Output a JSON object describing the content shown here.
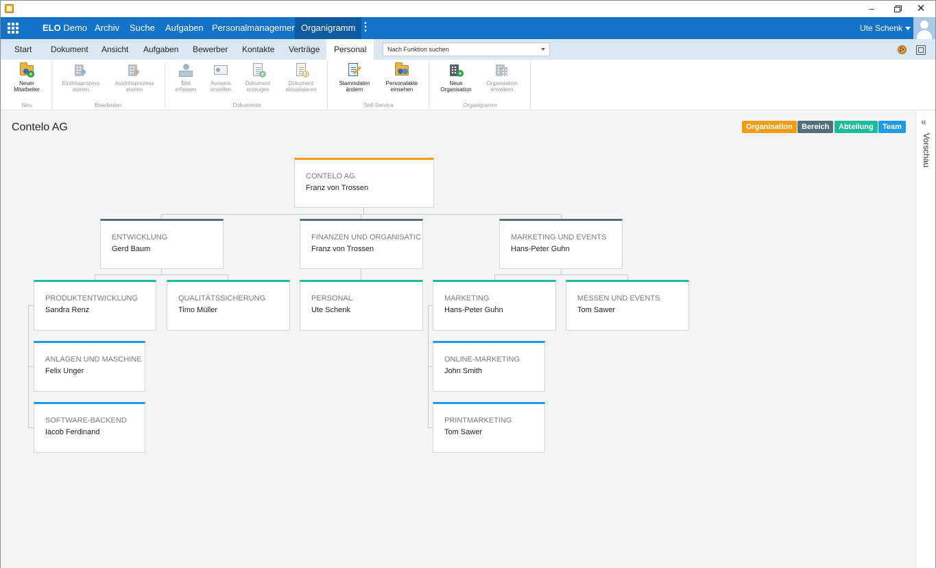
{
  "window": {
    "minimize": "–",
    "close": "✕"
  },
  "topnav": {
    "brand_bold": "ELO",
    "brand_rest": "Demo",
    "items": [
      "Archiv",
      "Suche",
      "Aufgaben",
      "Personalmanagement",
      "Organigramm"
    ],
    "active": "Organigramm",
    "more": "⋮",
    "user": "Ute Schenk"
  },
  "ribbon_tabs": {
    "items": [
      "Start",
      "Dokument",
      "Ansicht",
      "Aufgaben",
      "Bewerber",
      "Kontakte",
      "Verträge",
      "Personal"
    ],
    "active": "Personal",
    "search_placeholder": "Nach Funktion suchen"
  },
  "ribbon": {
    "buttons": [
      {
        "label_1": "Neuer",
        "label_2": "Mitarbeiter",
        "icon": "new-employee-icon",
        "enabled": true
      },
      {
        "label_1": "Eintrittsprozess",
        "label_2": "starten",
        "icon": "entry-process-icon",
        "enabled": false
      },
      {
        "label_1": "Austrittsprozess",
        "label_2": "starten",
        "icon": "exit-process-icon",
        "enabled": false
      },
      {
        "label_1": "Bild",
        "label_2": "erfassen",
        "icon": "capture-photo-icon",
        "enabled": false
      },
      {
        "label_1": "Ausweis",
        "label_2": "erstellen",
        "icon": "id-card-icon",
        "enabled": false
      },
      {
        "label_1": "Dokument",
        "label_2": "erzeugen",
        "icon": "create-document-icon",
        "enabled": false
      },
      {
        "label_1": "Dokument",
        "label_2": "aktualisieren",
        "icon": "update-document-icon",
        "enabled": false
      },
      {
        "label_1": "Stammdaten",
        "label_2": "ändern",
        "icon": "edit-master-data-icon",
        "enabled": true
      },
      {
        "label_1": "Personalakte",
        "label_2": "einsehen",
        "icon": "personnel-file-icon",
        "enabled": true
      },
      {
        "label_1": "Neue",
        "label_2": "Organisation",
        "icon": "new-organization-icon",
        "enabled": true
      },
      {
        "label_1": "Organisation",
        "label_2": "erweitern",
        "icon": "extend-organization-icon",
        "enabled": false
      }
    ],
    "groups": [
      "Neu",
      "Bearbeiten",
      "Dokumente",
      "Self-Service",
      "Organigramm"
    ]
  },
  "page": {
    "title": "Contelo AG",
    "side_panel_label": "Vorschau",
    "collapse": "«"
  },
  "legend": [
    {
      "label": "Organisation",
      "color": "#f39c12"
    },
    {
      "label": "Bereich",
      "color": "#546e7a"
    },
    {
      "label": "Abteilung",
      "color": "#1abc9c"
    },
    {
      "label": "Team",
      "color": "#1e9be6"
    }
  ],
  "org_chart": {
    "nodes": [
      {
        "id": "contelo",
        "type": "Organisation",
        "title": "CONTELO AG",
        "person": "Franz von Trossen"
      },
      {
        "id": "entwicklung",
        "type": "Bereich",
        "title": "ENTWICKLUNG",
        "person": "Gerd Baum"
      },
      {
        "id": "finanzen",
        "type": "Bereich",
        "title": "FINANZEN UND ORGANISATIC",
        "person": "Franz von Trossen"
      },
      {
        "id": "marketing-events",
        "type": "Bereich",
        "title": "MARKETING UND EVENTS",
        "person": "Hans-Peter Guhn"
      },
      {
        "id": "produktentwicklung",
        "type": "Abteilung",
        "title": "PRODUKTENTWICKLUNG",
        "person": "Sandra Renz"
      },
      {
        "id": "qualitaet",
        "type": "Abteilung",
        "title": "QUALITÄTSSICHERUNG",
        "person": "Timo Müller"
      },
      {
        "id": "personal",
        "type": "Abteilung",
        "title": "PERSONAL",
        "person": "Ute Schenk"
      },
      {
        "id": "marketing",
        "type": "Abteilung",
        "title": "MARKETING",
        "person": "Hans-Peter Guhn"
      },
      {
        "id": "messen",
        "type": "Abteilung",
        "title": "MESSEN UND EVENTS",
        "person": "Tom Sawer"
      },
      {
        "id": "anlagen",
        "type": "Team",
        "title": "ANLAGEN UND MASCHINE",
        "person": "Felix Unger"
      },
      {
        "id": "software",
        "type": "Team",
        "title": "SOFTWARE-BACKEND",
        "person": "Iacob Ferdinand"
      },
      {
        "id": "online-marketing",
        "type": "Team",
        "title": "ONLINE-MARKETING",
        "person": "John Smith"
      },
      {
        "id": "printmarketing",
        "type": "Team",
        "title": "PRINTMARKETING",
        "person": "Tom Sawer"
      }
    ]
  }
}
